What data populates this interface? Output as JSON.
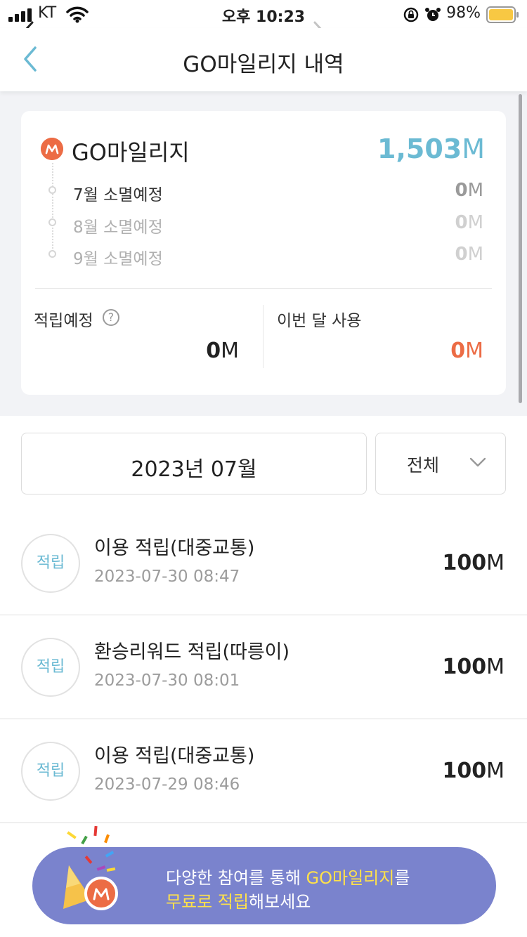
{
  "status_bar": {
    "carrier": "KT",
    "time": "오후 10:23",
    "battery_percent": "98%"
  },
  "header": {
    "title": "GO마일리지 내역"
  },
  "summary": {
    "brand_icon_letter": "M",
    "title": "GO마일리지",
    "total_value": "1,503",
    "unit": "M",
    "expirations": [
      {
        "label": "7월 소멸예정",
        "value": "0"
      },
      {
        "label": "8월 소멸예정",
        "value": "0"
      },
      {
        "label": "9월 소멸예정",
        "value": "0"
      }
    ],
    "pending": {
      "label": "적립예정",
      "help": "?",
      "value": "0"
    },
    "this_month_use": {
      "label": "이번 달 사용",
      "value": "0"
    }
  },
  "month_selector": {
    "month": "2023년 07월",
    "filter": "전체"
  },
  "transactions": [
    {
      "type": "적립",
      "title": "이용 적립(대중교통)",
      "datetime": "2023-07-30 08:47",
      "amount": "100"
    },
    {
      "type": "적립",
      "title": "환승리워드 적립(따릉이)",
      "datetime": "2023-07-30 08:01",
      "amount": "100"
    },
    {
      "type": "적립",
      "title": "이용 적립(대중교통)",
      "datetime": "2023-07-29 08:46",
      "amount": "100"
    }
  ],
  "banner": {
    "line1_prefix": "다양한 참여를 통해 ",
    "line1_highlight": "GO마일리지",
    "line1_suffix": "를",
    "line2_highlight": "무료로 적립",
    "line2_suffix": "해보세요"
  },
  "colors": {
    "accent_blue": "#6bbad3",
    "accent_orange": "#ec6c45",
    "banner_bg": "#7a83cd",
    "banner_highlight": "#ffe14a",
    "battery": "#f8c843"
  }
}
